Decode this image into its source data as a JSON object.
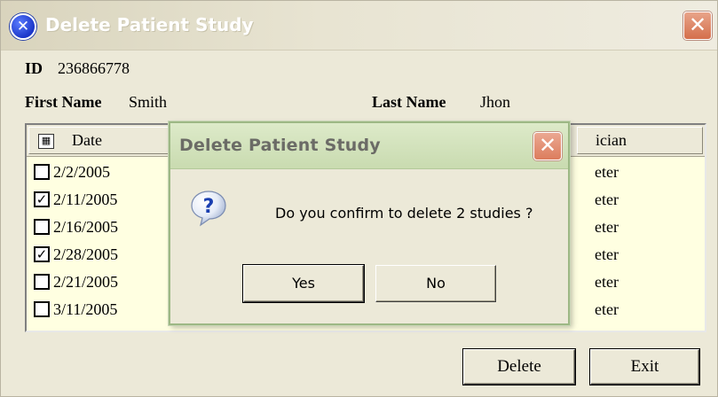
{
  "window": {
    "title": "Delete Patient Study",
    "close_glyph": "✕",
    "icon": "delete-x-icon"
  },
  "patient": {
    "id_label": "ID",
    "id_value": "236866778",
    "first_name_label": "First Name",
    "first_name_value": "Smith",
    "last_name_label": "Last Name",
    "last_name_value": "Jhon"
  },
  "list": {
    "columns": [
      {
        "label": "Date"
      },
      {
        "label": "ician"
      }
    ],
    "rows": [
      {
        "date": "2/2/2005",
        "checked": false,
        "physician_partial": "eter"
      },
      {
        "date": "2/11/2005",
        "checked": true,
        "physician_partial": "eter"
      },
      {
        "date": "2/16/2005",
        "checked": false,
        "physician_partial": "eter"
      },
      {
        "date": "2/28/2005",
        "checked": true,
        "physician_partial": "eter"
      },
      {
        "date": "2/21/2005",
        "checked": false,
        "physician_partial": "eter"
      },
      {
        "date": "3/11/2005",
        "checked": false,
        "physician_partial": "eter"
      }
    ],
    "background_color": "#ffffe1"
  },
  "buttons": {
    "delete_label": "Delete",
    "exit_label": "Exit"
  },
  "dialog": {
    "title": "Delete Patient Study",
    "close_glyph": "✕",
    "icon": "question-icon",
    "message": "Do you confirm to delete 2 studies ?",
    "yes_label": "Yes",
    "no_label": "No",
    "title_color": "#c9dbb0"
  }
}
